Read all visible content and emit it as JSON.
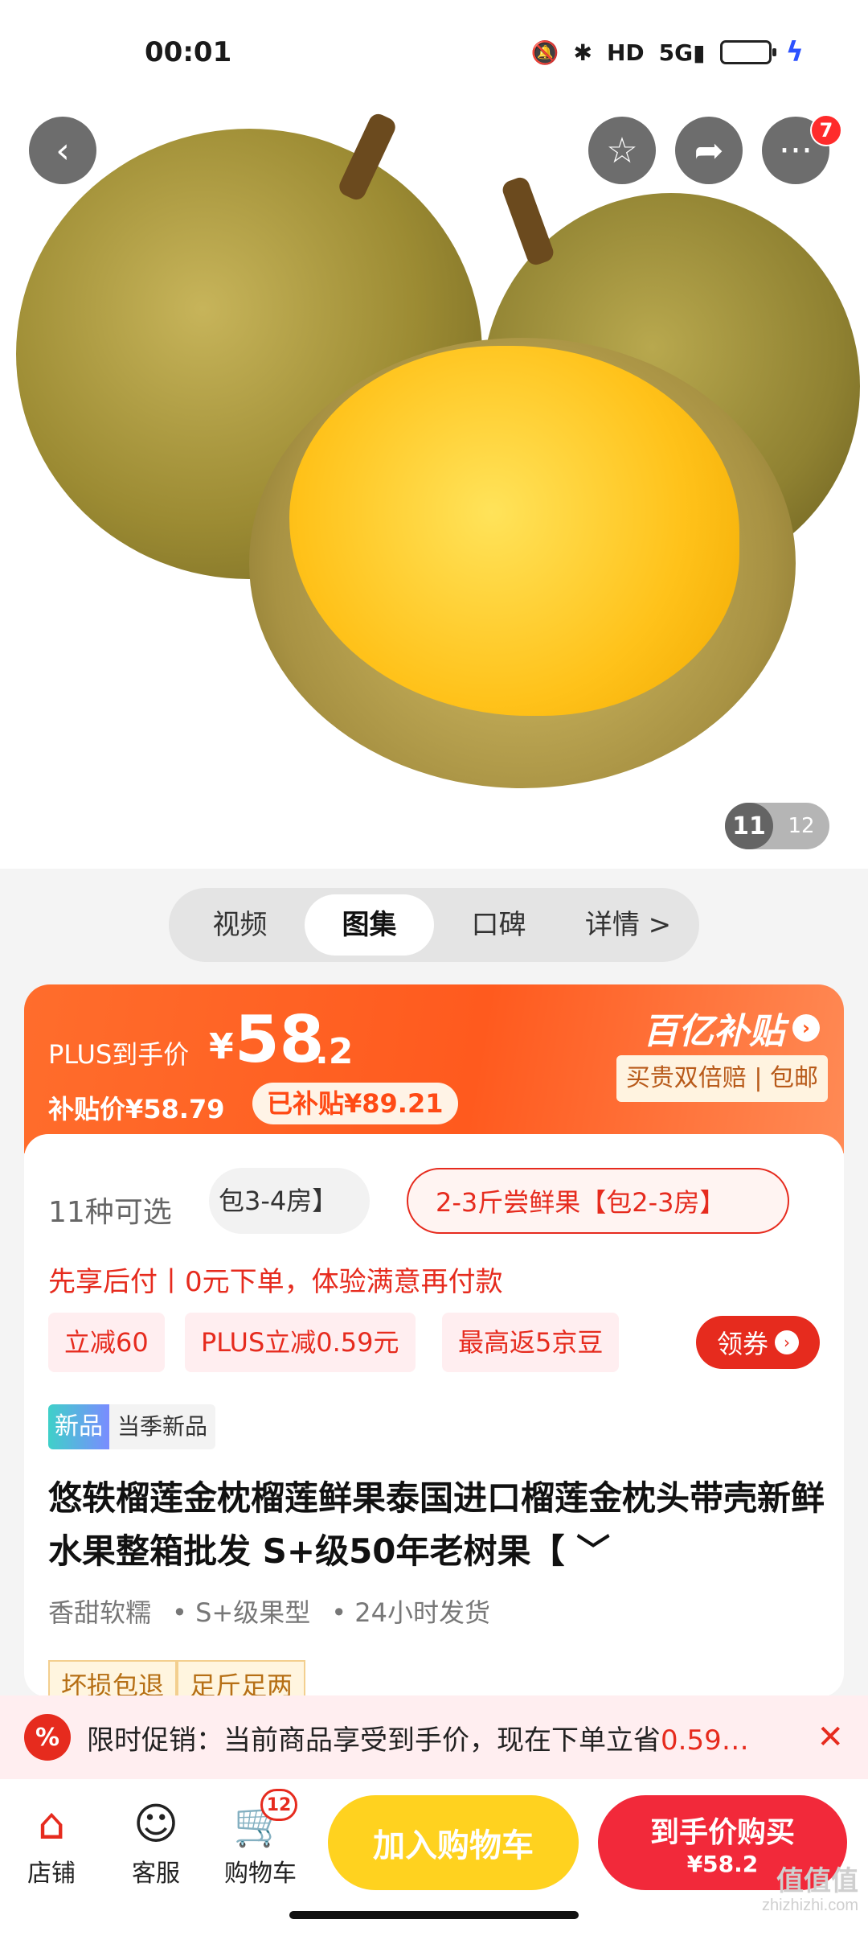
{
  "status_bar": {
    "time": "00:01",
    "icons": [
      "mute-icon",
      "bluetooth-icon",
      "hd-icon",
      "5g-signal-icon",
      "battery-icon",
      "charging-icon"
    ],
    "hd_label": "HD",
    "network_label": "5G"
  },
  "top_actions": {
    "more_badge": "7"
  },
  "gallery": {
    "current": "11",
    "total": "12"
  },
  "media_tabs": [
    {
      "label": "视频"
    },
    {
      "label": "图集"
    },
    {
      "label": "口碑"
    },
    {
      "label": "详情 >"
    }
  ],
  "price": {
    "plus_label": "PLUS到手价",
    "yen": "¥",
    "main": "58",
    "decimal": ".2",
    "subsidy_price": "补贴价¥58.79",
    "subsidized": "已补贴¥89.21",
    "program_title": "百亿补贴",
    "program_tag": "买贵双倍赔 | 包邮"
  },
  "variants": {
    "count_label": "11种可选",
    "options": [
      "包3-4房】",
      "2-3斤尝鲜果【包2-3房】"
    ]
  },
  "pay_later": "先享后付丨0元下单，体验满意再付款",
  "coupons": [
    "立减60",
    "PLUS立减0.59元",
    "最高返5京豆"
  ],
  "get_coupon_label": "领券",
  "new_tag": {
    "label": "新品",
    "text": "当季新品"
  },
  "product_title": "悠轶榴莲金枕榴莲鲜果泰国进口榴莲金枕头带壳新鲜水果整箱批发 S+级50年老树果【 ﹀",
  "attributes": [
    "香甜软糯",
    "• S+级果型",
    "• 24小时发货"
  ],
  "service_badges": [
    "坏损包退",
    "足斤足两"
  ],
  "promo": {
    "icon_label": "%",
    "text": "限时促销：当前商品享受到手价，现在下单立省",
    "save": "0.59…",
    "close": "✕"
  },
  "bottom_bar": {
    "store": "店铺",
    "service": "客服",
    "cart": "购物车",
    "cart_count": "12",
    "add_cart": "加入购物车",
    "buy_now": "到手价购买",
    "buy_now_price": "¥58.2"
  },
  "watermark": {
    "main": "值值值",
    "sub": "zhizhizhi.com"
  }
}
